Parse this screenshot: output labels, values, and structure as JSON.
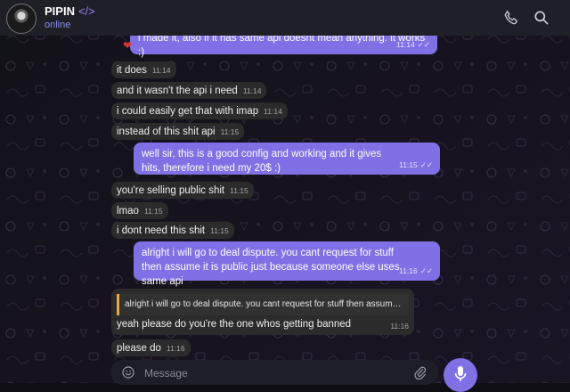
{
  "header": {
    "name": "PIPIN",
    "name_code": "</>",
    "status": "online"
  },
  "messages": [
    {
      "dir": "out",
      "text": "i made it, also if it has same api doesnt mean anything. it works :)",
      "time": "11:14",
      "ticks": "✓✓"
    },
    {
      "dir": "in",
      "text": "it does",
      "time": "11:14"
    },
    {
      "dir": "in",
      "text": "and it wasn't the api i need",
      "time": "11:14"
    },
    {
      "dir": "in",
      "text": "i could easily get that with imap",
      "time": "11:14"
    },
    {
      "dir": "in",
      "text": "instead of this shit api",
      "time": "11:15"
    },
    {
      "dir": "out",
      "text": "well sir, this is a good config and working and it gives hits, therefore i need my 20$ :)",
      "time": "11:15",
      "ticks": "✓✓"
    },
    {
      "dir": "in",
      "text": "you're selling public shit",
      "time": "11:15"
    },
    {
      "dir": "in",
      "text": "lmao",
      "time": "11:15"
    },
    {
      "dir": "in",
      "text": "i dont need this shit",
      "time": "11:15"
    },
    {
      "dir": "out",
      "text": "alright i will go to deal dispute. you cant request for stuff then assume it is public just because someone else uses same api",
      "time": "11:16",
      "ticks": "✓✓"
    },
    {
      "dir": "in",
      "reply_to": "alright i will go to deal dispute. you cant request for stuff then assume it...",
      "text": "yeah please do you're the one whos getting banned",
      "time": "11:16"
    },
    {
      "dir": "in",
      "text": "please do",
      "time": "11:16"
    }
  ],
  "reaction": "heart",
  "input": {
    "placeholder": "Message"
  },
  "colors": {
    "header_bg": "#1f1f27",
    "outgoing_bubble": "#8070e6",
    "incoming_bubble": "#2b2b2b",
    "status_text": "#8e8ef0",
    "reply_bar": "#f2a33d"
  },
  "icons": {
    "call": "phone-icon",
    "search": "search-icon",
    "emoji": "emoji-icon",
    "attach": "paperclip-icon",
    "mic": "microphone-icon"
  }
}
